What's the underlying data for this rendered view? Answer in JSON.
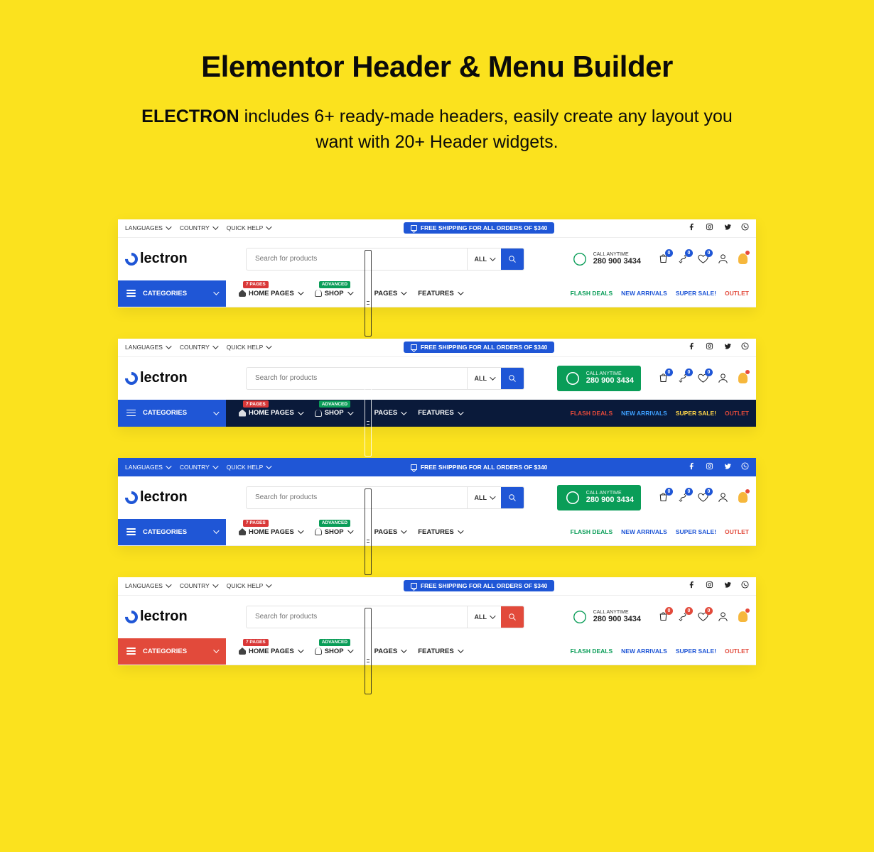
{
  "hero": {
    "title": "Elementor Header & Menu Builder",
    "brand": "ELECTRON",
    "desc_rest": " includes 6+ ready-made headers, easily create any layout you want with 20+ Header widgets."
  },
  "common": {
    "topbar": {
      "languages": "LANGUAGES",
      "country": "COUNTRY",
      "quickhelp": "QUICK HELP"
    },
    "shipping": "FREE SHIPPING FOR ALL ORDERS OF $340",
    "logo": "lectron",
    "search": {
      "placeholder": "Search for products",
      "all": "ALL"
    },
    "call": {
      "label": "CALL ANYTIME",
      "number": "280 900 3434"
    },
    "cat": "CATEGORIES",
    "menu": {
      "home": "HOME PAGES",
      "shop": "SHOP",
      "pages": "PAGES",
      "features": "FEATURES",
      "tag_pages": "7 PAGES",
      "tag_adv": "ADVANCED"
    },
    "deals": {
      "flash": "FLASH DEALS",
      "new": "NEW ARRIVALS",
      "sale": "SUPER SALE!",
      "outlet": "OUTLET"
    },
    "badges": {
      "cart": "0",
      "compare": "0",
      "wish": "0"
    }
  },
  "variants": [
    {
      "topbar_class": "",
      "nav_class": "",
      "nav_bg": "#ffffff",
      "nav_border": true,
      "catbtn_bg": "#1f56d6",
      "search_btn": "#1f56d6",
      "call_boxed": false,
      "badge_color": "#1f56d6",
      "deal_colors": {
        "flash": "#0a9d58",
        "new": "#1f56d6",
        "sale": "#1f56d6",
        "outlet": "#e24a3b"
      },
      "tag_pages_bg": "#d93838",
      "tag_adv_bg": "#0a9d58"
    },
    {
      "topbar_class": "",
      "nav_class": "nav-dark",
      "nav_bg": "#0a1a3a",
      "nav_border": false,
      "catbtn_bg": "#1f56d6",
      "search_btn": "#1f56d6",
      "call_boxed": true,
      "badge_color": "#1f56d6",
      "deal_colors": {
        "flash": "#e24a3b",
        "new": "#3ea0ff",
        "sale": "#ffd64a",
        "outlet": "#e24a3b"
      },
      "tag_pages_bg": "#d93838",
      "tag_adv_bg": "#0a9d58"
    },
    {
      "topbar_class": "tb-blue",
      "nav_class": "",
      "nav_bg": "#ffffff",
      "nav_border": true,
      "catbtn_bg": "#1f56d6",
      "search_btn": "#1f56d6",
      "call_boxed": true,
      "badge_color": "#1f56d6",
      "deal_colors": {
        "flash": "#0a9d58",
        "new": "#1f56d6",
        "sale": "#1f56d6",
        "outlet": "#e24a3b"
      },
      "tag_pages_bg": "#d93838",
      "tag_adv_bg": "#0a9d58"
    },
    {
      "topbar_class": "",
      "nav_class": "",
      "nav_bg": "#ffffff",
      "nav_border": true,
      "catbtn_bg": "#e24a3b",
      "search_btn": "#e24a3b",
      "call_boxed": false,
      "badge_color": "#e24a3b",
      "deal_colors": {
        "flash": "#0a9d58",
        "new": "#1f56d6",
        "sale": "#1f56d6",
        "outlet": "#e24a3b"
      },
      "tag_pages_bg": "#d93838",
      "tag_adv_bg": "#0a9d58"
    }
  ]
}
